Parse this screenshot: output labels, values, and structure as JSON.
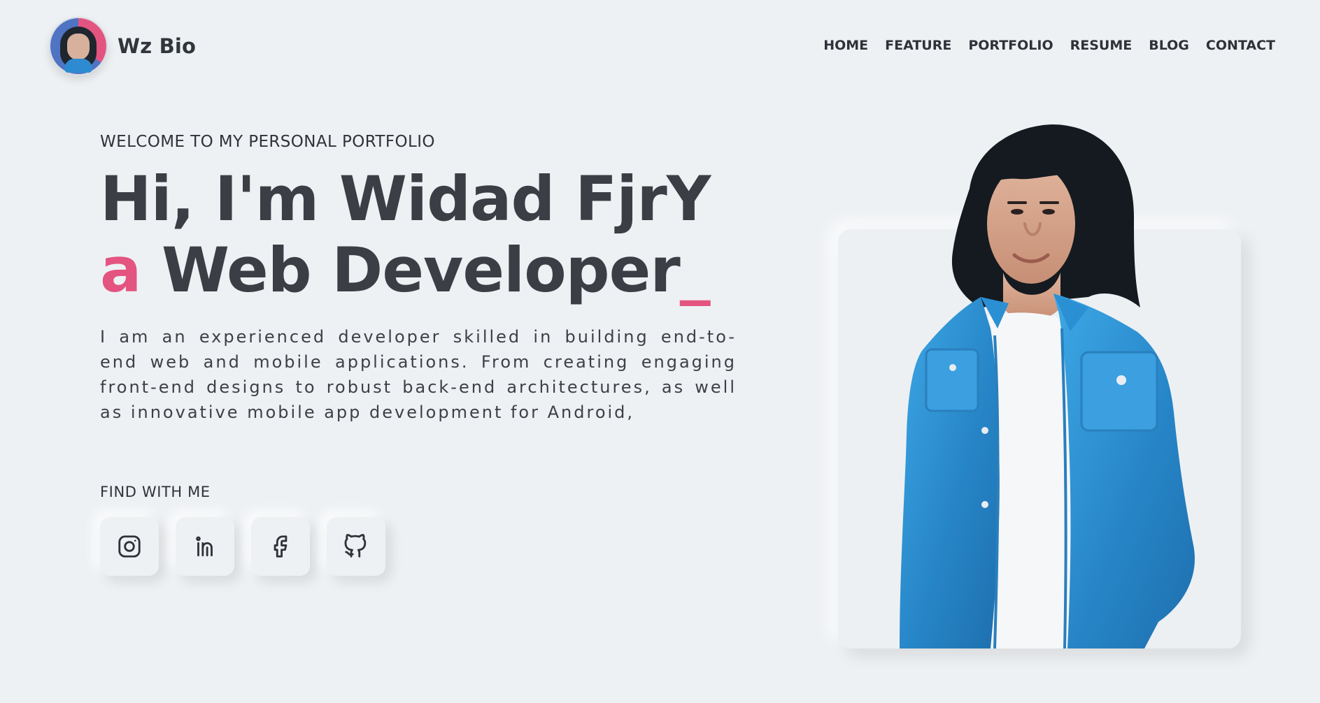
{
  "header": {
    "brand_name": "Wz Bio",
    "nav_items": [
      "HOME",
      "FEATURE",
      "PORTFOLIO",
      "RESUME",
      "BLOG",
      "CONTACT"
    ]
  },
  "hero": {
    "welcome": "WELCOME TO MY PERSONAL PORTFOLIO",
    "title_line1": "Hi, I'm Widad FjrY",
    "title_accent": "a",
    "title_role": "Web Developer",
    "title_cursor": "_",
    "description": "I am an experienced developer skilled in building end-to-end web and mobile applications. From creating engaging front-end designs to robust back-end architectures, as well as innovative mobile app development for Android,",
    "find_label": "FIND WITH ME",
    "social_icons": [
      "instagram-icon",
      "linkedin-icon",
      "facebook-icon",
      "github-icon"
    ]
  },
  "colors": {
    "accent": "#e45480",
    "background": "#eef1f4",
    "text": "#3b3f45"
  }
}
